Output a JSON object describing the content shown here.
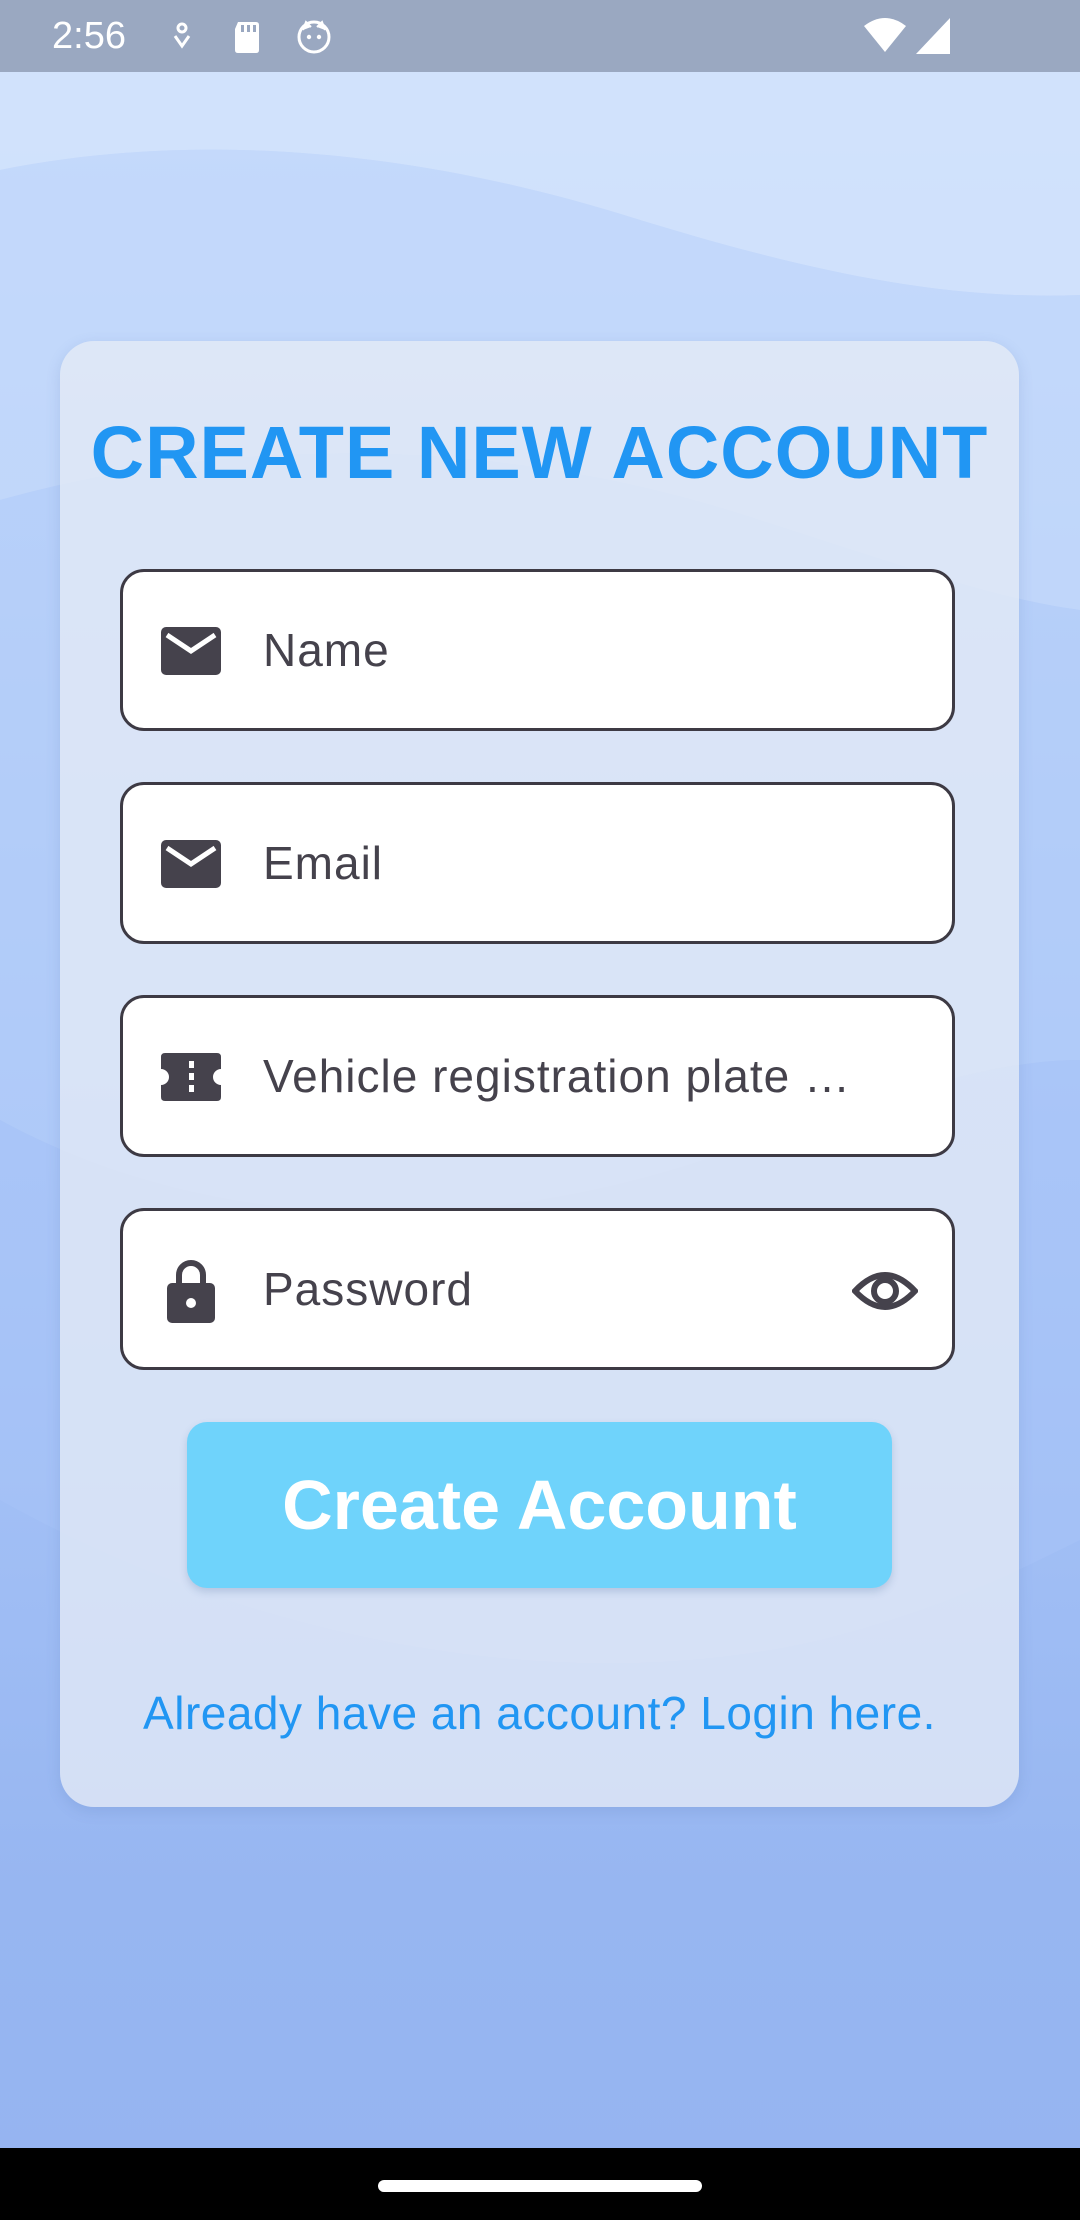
{
  "status_bar": {
    "time": "2:56",
    "icons": [
      "sync-icon",
      "sd-card-icon",
      "cat-icon",
      "wifi-icon",
      "cellular-signal-icon"
    ]
  },
  "form": {
    "title": "CREATE NEW ACCOUNT",
    "fields": [
      {
        "label": "Name",
        "icon": "mail-icon"
      },
      {
        "label": "Email",
        "icon": "mail-icon"
      },
      {
        "label": "Vehicle registration plate …",
        "icon": "ticket-icon"
      },
      {
        "label": "Password",
        "icon": "lock-icon",
        "trailing_icon": "eye-icon"
      }
    ],
    "submit_label": "Create Account",
    "login_link": "Already have an account? Login here."
  },
  "colors": {
    "accent": "#2196f3",
    "button": "#6fd3fb",
    "field_border": "#3d3a44"
  }
}
